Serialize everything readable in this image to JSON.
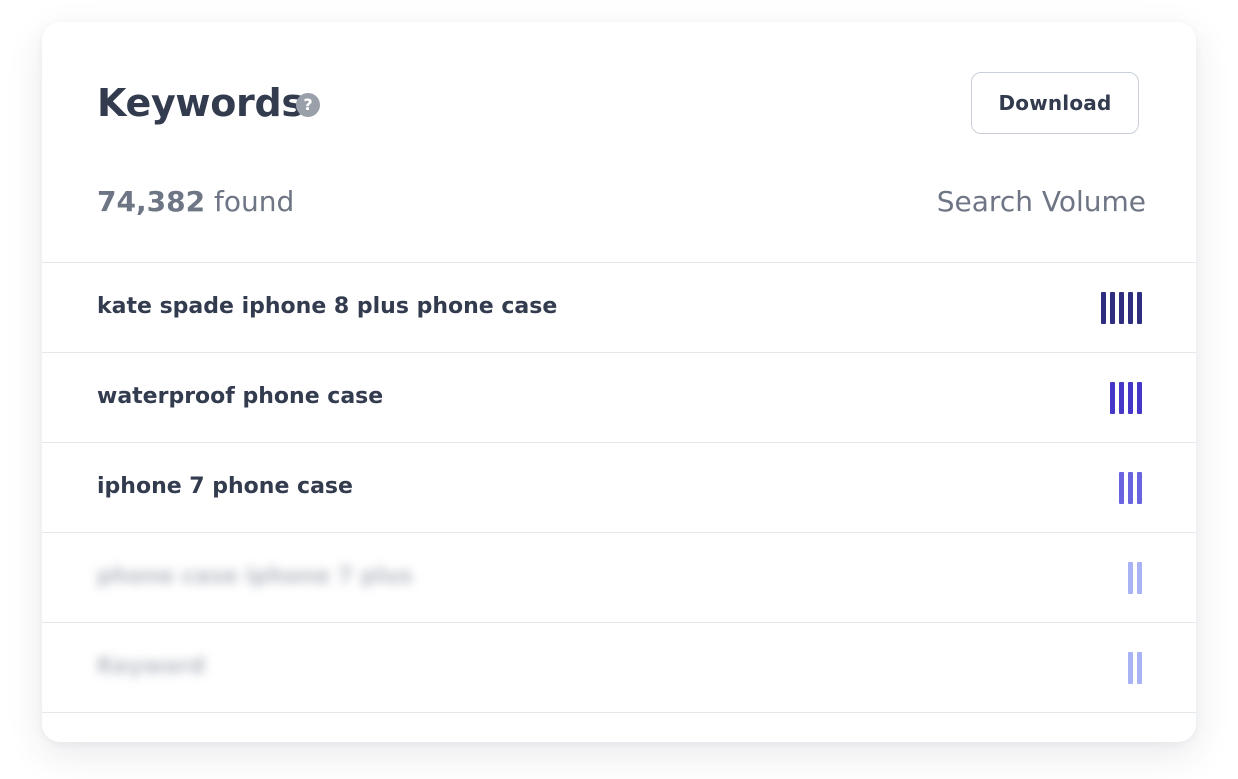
{
  "header": {
    "title": "Keywords",
    "help_icon": "?",
    "download_label": "Download"
  },
  "summary": {
    "count": "74,382",
    "found_label": " found",
    "column_label": "Search Volume"
  },
  "keywords": [
    {
      "text": "kate spade iphone 8 plus phone case",
      "volume_level": 5,
      "color": "#2f2d80",
      "blurred": false
    },
    {
      "text": "waterproof phone case",
      "volume_level": 4,
      "color": "#4537c8",
      "blurred": false
    },
    {
      "text": "iphone 7 phone case",
      "volume_level": 3,
      "color": "#6a63e0",
      "blurred": false
    },
    {
      "text": "phone case iphone 7 plus",
      "volume_level": 2,
      "color": "#a8b2f5",
      "blurred": true
    },
    {
      "text": "Keyword",
      "volume_level": 2,
      "color": "#a8b2f5",
      "blurred": true
    }
  ]
}
